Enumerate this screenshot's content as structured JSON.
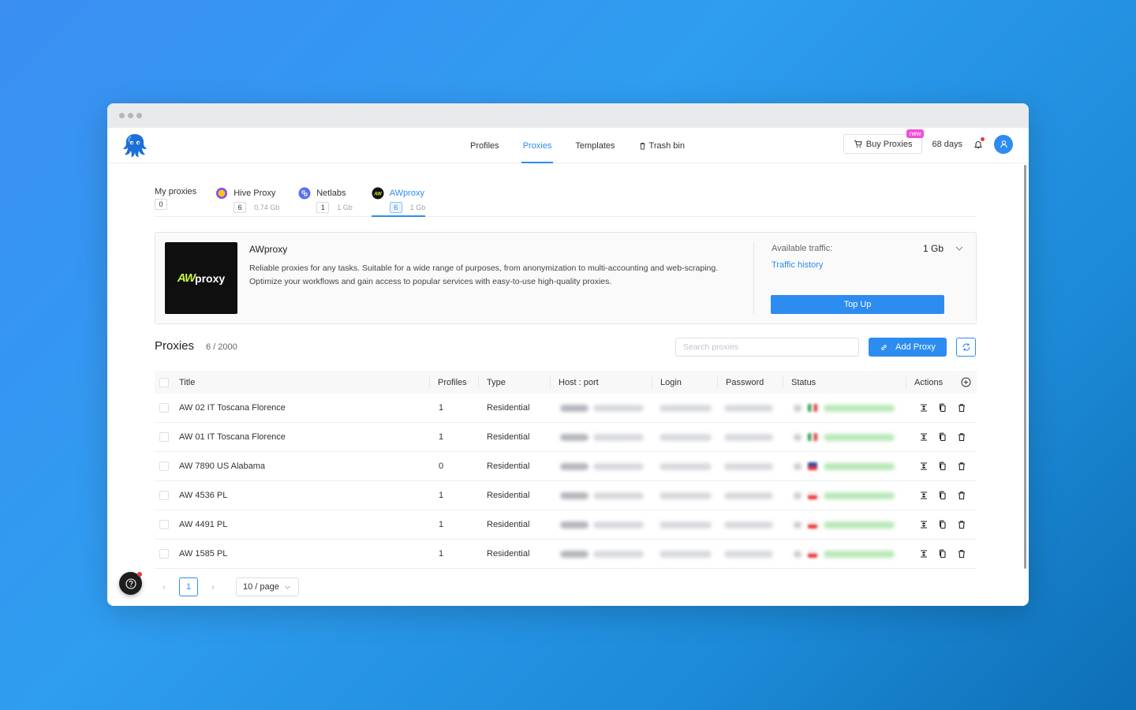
{
  "nav": {
    "items": [
      {
        "label": "Profiles",
        "active": false,
        "name": "nav-profiles"
      },
      {
        "label": "Proxies",
        "active": true,
        "name": "nav-proxies"
      },
      {
        "label": "Templates",
        "active": false,
        "name": "nav-templates"
      },
      {
        "label": "Trash bin",
        "active": false,
        "name": "nav-trash-bin"
      }
    ],
    "buy_proxies": "Buy Proxies",
    "new_badge": "new",
    "days": "68 days"
  },
  "providers": [
    {
      "label": "My proxies",
      "count": "0",
      "traffic": "",
      "icon": "none"
    },
    {
      "label": "Hive Proxy",
      "count": "6",
      "traffic": "0.74 Gb",
      "icon": "hive-icon"
    },
    {
      "label": "Netlabs",
      "count": "1",
      "traffic": "1 Gb",
      "icon": "netlabs-icon"
    },
    {
      "label": "AWproxy",
      "count": "6",
      "traffic": "1 Gb",
      "icon": "awproxy-icon",
      "active": true
    }
  ],
  "info": {
    "logo_aw": "AW",
    "logo_proxy": "proxy",
    "title": "AWproxy",
    "description": "Reliable proxies for any tasks. Suitable for a wide range of purposes, from anonymization to multi-accounting and web-scraping. Optimize your workflows and gain access to popular services with easy-to-use high-quality proxies.",
    "traffic_label": "Available traffic:",
    "traffic_value": "1 Gb",
    "traffic_history": "Traffic history",
    "top_up": "Top Up"
  },
  "proxies": {
    "title": "Proxies",
    "count": "6 / 2000",
    "search_placeholder": "Search proxies",
    "add_proxy": "Add Proxy"
  },
  "table": {
    "columns": [
      "Title",
      "Profiles",
      "Type",
      "Host : port",
      "Login",
      "Password",
      "Status",
      "Actions"
    ],
    "rows": [
      {
        "title": "AW 02 IT Toscana Florence",
        "profiles": "1",
        "type": "Residential",
        "flag": "it"
      },
      {
        "title": "AW 01 IT Toscana Florence",
        "profiles": "1",
        "type": "Residential",
        "flag": "it"
      },
      {
        "title": "AW 7890 US Alabama",
        "profiles": "0",
        "type": "Residential",
        "flag": "us"
      },
      {
        "title": "AW 4536 PL",
        "profiles": "1",
        "type": "Residential",
        "flag": "pl"
      },
      {
        "title": "AW 4491 PL",
        "profiles": "1",
        "type": "Residential",
        "flag": "pl"
      },
      {
        "title": "AW 1585 PL",
        "profiles": "1",
        "type": "Residential",
        "flag": "pl"
      }
    ]
  },
  "pager": {
    "page": "1",
    "page_size": "10 / page"
  },
  "colors": {
    "accent": "#2d8cf0",
    "aw_green": "#c3f53c",
    "new_pink": "#f24ed4"
  }
}
